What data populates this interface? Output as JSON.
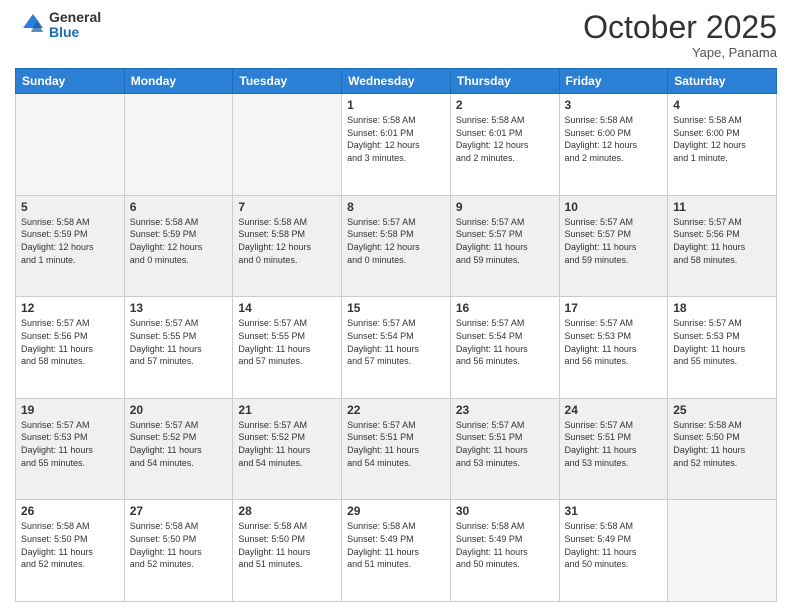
{
  "header": {
    "logo_general": "General",
    "logo_blue": "Blue",
    "month_title": "October 2025",
    "location": "Yape, Panama"
  },
  "weekdays": [
    "Sunday",
    "Monday",
    "Tuesday",
    "Wednesday",
    "Thursday",
    "Friday",
    "Saturday"
  ],
  "weeks": [
    [
      {
        "day": "",
        "info": ""
      },
      {
        "day": "",
        "info": ""
      },
      {
        "day": "",
        "info": ""
      },
      {
        "day": "1",
        "info": "Sunrise: 5:58 AM\nSunset: 6:01 PM\nDaylight: 12 hours\nand 3 minutes."
      },
      {
        "day": "2",
        "info": "Sunrise: 5:58 AM\nSunset: 6:01 PM\nDaylight: 12 hours\nand 2 minutes."
      },
      {
        "day": "3",
        "info": "Sunrise: 5:58 AM\nSunset: 6:00 PM\nDaylight: 12 hours\nand 2 minutes."
      },
      {
        "day": "4",
        "info": "Sunrise: 5:58 AM\nSunset: 6:00 PM\nDaylight: 12 hours\nand 1 minute."
      }
    ],
    [
      {
        "day": "5",
        "info": "Sunrise: 5:58 AM\nSunset: 5:59 PM\nDaylight: 12 hours\nand 1 minute."
      },
      {
        "day": "6",
        "info": "Sunrise: 5:58 AM\nSunset: 5:59 PM\nDaylight: 12 hours\nand 0 minutes."
      },
      {
        "day": "7",
        "info": "Sunrise: 5:58 AM\nSunset: 5:58 PM\nDaylight: 12 hours\nand 0 minutes."
      },
      {
        "day": "8",
        "info": "Sunrise: 5:57 AM\nSunset: 5:58 PM\nDaylight: 12 hours\nand 0 minutes."
      },
      {
        "day": "9",
        "info": "Sunrise: 5:57 AM\nSunset: 5:57 PM\nDaylight: 11 hours\nand 59 minutes."
      },
      {
        "day": "10",
        "info": "Sunrise: 5:57 AM\nSunset: 5:57 PM\nDaylight: 11 hours\nand 59 minutes."
      },
      {
        "day": "11",
        "info": "Sunrise: 5:57 AM\nSunset: 5:56 PM\nDaylight: 11 hours\nand 58 minutes."
      }
    ],
    [
      {
        "day": "12",
        "info": "Sunrise: 5:57 AM\nSunset: 5:56 PM\nDaylight: 11 hours\nand 58 minutes."
      },
      {
        "day": "13",
        "info": "Sunrise: 5:57 AM\nSunset: 5:55 PM\nDaylight: 11 hours\nand 57 minutes."
      },
      {
        "day": "14",
        "info": "Sunrise: 5:57 AM\nSunset: 5:55 PM\nDaylight: 11 hours\nand 57 minutes."
      },
      {
        "day": "15",
        "info": "Sunrise: 5:57 AM\nSunset: 5:54 PM\nDaylight: 11 hours\nand 57 minutes."
      },
      {
        "day": "16",
        "info": "Sunrise: 5:57 AM\nSunset: 5:54 PM\nDaylight: 11 hours\nand 56 minutes."
      },
      {
        "day": "17",
        "info": "Sunrise: 5:57 AM\nSunset: 5:53 PM\nDaylight: 11 hours\nand 56 minutes."
      },
      {
        "day": "18",
        "info": "Sunrise: 5:57 AM\nSunset: 5:53 PM\nDaylight: 11 hours\nand 55 minutes."
      }
    ],
    [
      {
        "day": "19",
        "info": "Sunrise: 5:57 AM\nSunset: 5:53 PM\nDaylight: 11 hours\nand 55 minutes."
      },
      {
        "day": "20",
        "info": "Sunrise: 5:57 AM\nSunset: 5:52 PM\nDaylight: 11 hours\nand 54 minutes."
      },
      {
        "day": "21",
        "info": "Sunrise: 5:57 AM\nSunset: 5:52 PM\nDaylight: 11 hours\nand 54 minutes."
      },
      {
        "day": "22",
        "info": "Sunrise: 5:57 AM\nSunset: 5:51 PM\nDaylight: 11 hours\nand 54 minutes."
      },
      {
        "day": "23",
        "info": "Sunrise: 5:57 AM\nSunset: 5:51 PM\nDaylight: 11 hours\nand 53 minutes."
      },
      {
        "day": "24",
        "info": "Sunrise: 5:57 AM\nSunset: 5:51 PM\nDaylight: 11 hours\nand 53 minutes."
      },
      {
        "day": "25",
        "info": "Sunrise: 5:58 AM\nSunset: 5:50 PM\nDaylight: 11 hours\nand 52 minutes."
      }
    ],
    [
      {
        "day": "26",
        "info": "Sunrise: 5:58 AM\nSunset: 5:50 PM\nDaylight: 11 hours\nand 52 minutes."
      },
      {
        "day": "27",
        "info": "Sunrise: 5:58 AM\nSunset: 5:50 PM\nDaylight: 11 hours\nand 52 minutes."
      },
      {
        "day": "28",
        "info": "Sunrise: 5:58 AM\nSunset: 5:50 PM\nDaylight: 11 hours\nand 51 minutes."
      },
      {
        "day": "29",
        "info": "Sunrise: 5:58 AM\nSunset: 5:49 PM\nDaylight: 11 hours\nand 51 minutes."
      },
      {
        "day": "30",
        "info": "Sunrise: 5:58 AM\nSunset: 5:49 PM\nDaylight: 11 hours\nand 50 minutes."
      },
      {
        "day": "31",
        "info": "Sunrise: 5:58 AM\nSunset: 5:49 PM\nDaylight: 11 hours\nand 50 minutes."
      },
      {
        "day": "",
        "info": ""
      }
    ]
  ]
}
